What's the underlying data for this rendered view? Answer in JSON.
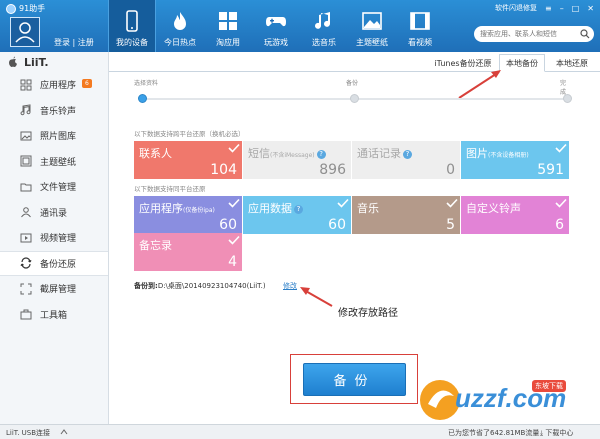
{
  "app": {
    "title": "91助手"
  },
  "header": {
    "login": "登录",
    "register": "注册",
    "top_right": {
      "flash_fix": "软件闪退修复"
    },
    "search_placeholder": "搜索应用、联系人和短信",
    "nav": [
      {
        "label": "我的设备",
        "icon": "phone-icon"
      },
      {
        "label": "今日热点",
        "icon": "flame-icon"
      },
      {
        "label": "淘应用",
        "icon": "apps-grid-icon"
      },
      {
        "label": "玩游戏",
        "icon": "gamepad-icon"
      },
      {
        "label": "选音乐",
        "icon": "music-note-icon"
      },
      {
        "label": "主题壁纸",
        "icon": "image-icon"
      },
      {
        "label": "看视频",
        "icon": "film-icon"
      }
    ]
  },
  "sidebar": {
    "device_name": "LiiT.",
    "items": [
      {
        "label": "应用程序",
        "icon": "apps-icon",
        "badge": "6"
      },
      {
        "label": "音乐铃声",
        "icon": "music-icon"
      },
      {
        "label": "照片图库",
        "icon": "photo-icon"
      },
      {
        "label": "主题壁纸",
        "icon": "wallpaper-icon"
      },
      {
        "label": "文件管理",
        "icon": "folder-icon"
      },
      {
        "label": "通讯录",
        "icon": "contacts-icon"
      },
      {
        "label": "视频管理",
        "icon": "video-icon"
      },
      {
        "label": "备份还原",
        "icon": "backup-icon",
        "active": true
      },
      {
        "label": "截屏管理",
        "icon": "screenshot-icon"
      },
      {
        "label": "工具箱",
        "icon": "toolbox-icon"
      }
    ]
  },
  "tabs": [
    {
      "label": "iTunes备份还原"
    },
    {
      "label": "本地备份",
      "active": true
    },
    {
      "label": "本地还原"
    }
  ],
  "steps": [
    "选择资料",
    "备份",
    "完成"
  ],
  "section1_label": "以下数据支持跨平台还原（换机必选）",
  "section2_label": "以下数据支持同平台还原",
  "tiles_row1": [
    {
      "name": "联系人",
      "sub": "",
      "count": "104",
      "color": "#f0786c",
      "checked": true,
      "disabled": false
    },
    {
      "name": "短信",
      "sub": "(不含iMessage)",
      "count": "896",
      "color": "#eeeeee",
      "checked": false,
      "disabled": true,
      "help": true
    },
    {
      "name": "通话记录",
      "sub": "",
      "count": "0",
      "color": "#eeeeee",
      "checked": false,
      "disabled": true,
      "help": true
    },
    {
      "name": "图片",
      "sub": "(不含设备相册)",
      "count": "591",
      "color": "#6cc6ee",
      "checked": true,
      "disabled": false
    }
  ],
  "tiles_row2": [
    {
      "name": "应用程序",
      "sub": "(仅备份ipa)",
      "count": "60",
      "color": "#8a8ee0",
      "checked": true,
      "disabled": false
    },
    {
      "name": "应用数据",
      "sub": "",
      "count": "60",
      "color": "#6cc6ee",
      "checked": true,
      "disabled": false,
      "help": true
    },
    {
      "name": "音乐",
      "sub": "",
      "count": "5",
      "color": "#b49a8a",
      "checked": true,
      "disabled": false
    },
    {
      "name": "自定义铃声",
      "sub": "",
      "count": "6",
      "color": "#e283d6",
      "checked": true,
      "disabled": false
    }
  ],
  "tiles_row3": [
    {
      "name": "备忘录",
      "sub": "",
      "count": "4",
      "color": "#f08fb6",
      "checked": true,
      "disabled": false
    }
  ],
  "path": {
    "label": "备份到:",
    "value": "D:\\桌面\\20140923104740(LiiT.)",
    "modify": "修改"
  },
  "annotation": "修改存放路径",
  "backup_button": "备份",
  "bottom": {
    "connection": "LiiT.  USB连接",
    "saved": "已为您节省了642.81MB流量",
    "download": "下载中心"
  },
  "watermark": {
    "text": "uzzf.com",
    "tag": "东坡下载"
  }
}
